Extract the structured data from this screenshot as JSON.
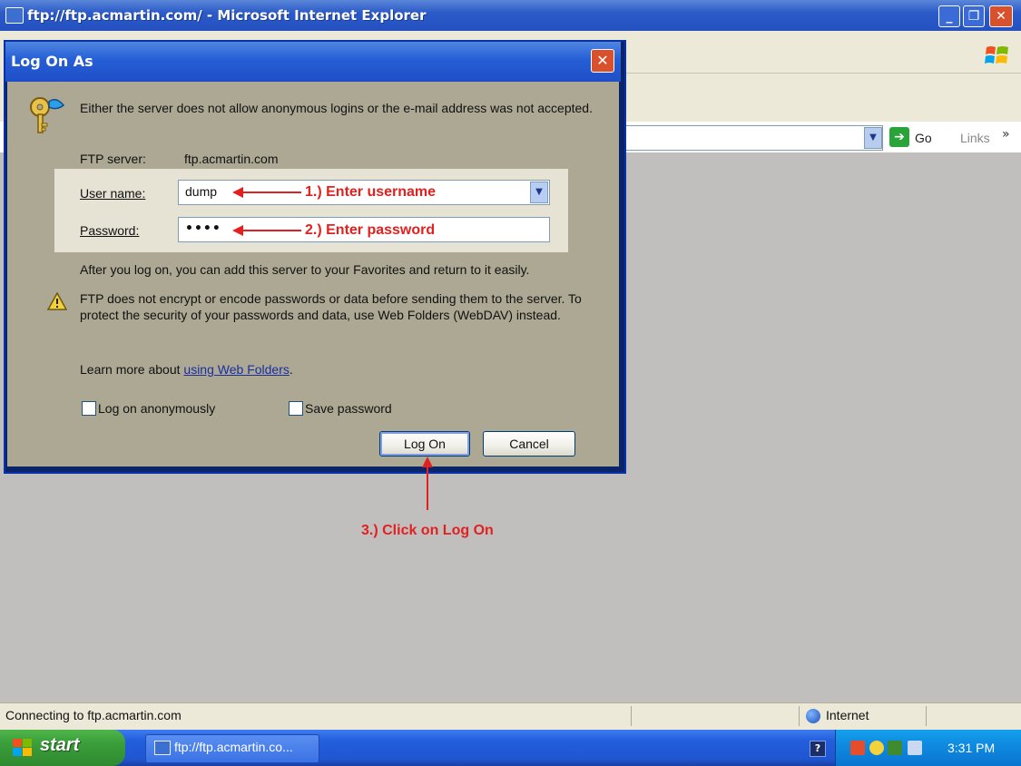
{
  "browser": {
    "title": "ftp://ftp.acmartin.com/ - Microsoft Internet Explorer",
    "go_label": "Go",
    "links_label": "Links",
    "links_chevron": "»",
    "status_text": "Connecting to ftp.acmartin.com",
    "zone_label": "Internet"
  },
  "dialog": {
    "title": "Log On As",
    "message": "Either the server does not allow anonymous logins or the e-mail address was not accepted.",
    "ftp_server_label": "FTP server:",
    "ftp_server_value": "ftp.acmartin.com",
    "username_label": "User name:",
    "username_value": "dump",
    "password_label": "Password:",
    "password_value": "••••",
    "after_logon_text": "After you log on, you can add this server to your Favorites and return to it easily.",
    "warning_text": "FTP does not encrypt or encode passwords or data before sending them to the server.  To protect the security of your passwords and data, use Web Folders (WebDAV) instead.",
    "learn_more_prefix": "Learn more about ",
    "learn_more_link": "using Web Folders",
    "learn_more_suffix": ".",
    "log_on_anonymously_label": "Log on anonymously",
    "log_on_anonymously_checked": false,
    "save_password_label": "Save password",
    "save_password_checked": false,
    "logon_button": "Log On",
    "cancel_button": "Cancel"
  },
  "annotations": {
    "step1": "1.)  Enter username",
    "step2": "2.)  Enter password",
    "step3": "3.)  Click on Log On",
    "color": "#e22020"
  },
  "taskbar": {
    "start_label": "start",
    "task_item_label": "ftp://ftp.acmartin.co...",
    "clock": "3:31 PM"
  },
  "icons": {
    "window_controls": [
      "minimize-icon",
      "maximize-icon",
      "close-icon"
    ],
    "dialog_icon": "key-icon",
    "warning_icon": "warning-icon",
    "zone_icon": "globe-icon"
  },
  "colors": {
    "xp_blue": "#245edb",
    "start_green": "#3a9d3a",
    "dialog_face": "#aca893"
  }
}
